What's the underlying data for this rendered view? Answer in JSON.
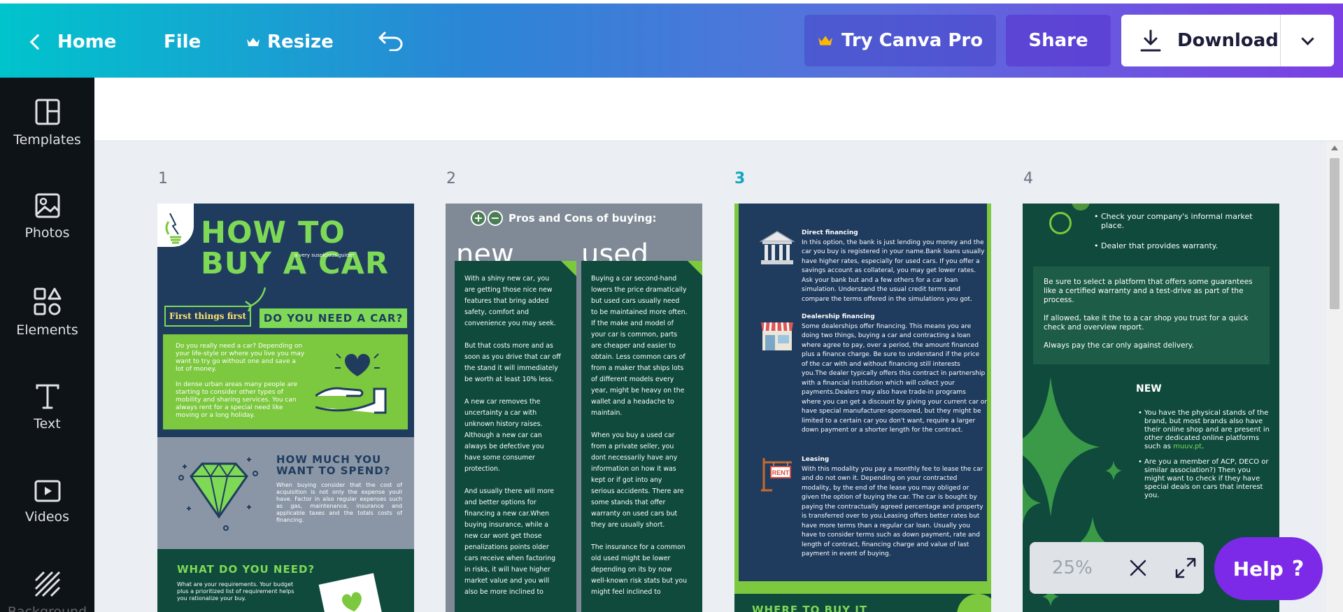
{
  "topbar": {
    "home_label": "Home",
    "file_label": "File",
    "resize_label": "Resize",
    "try_pro_label": "Try Canva Pro",
    "share_label": "Share",
    "download_label": "Download",
    "colors": {
      "gradient_start": "#00c4cc",
      "gradient_end": "#7b3fe4",
      "crown": "#ffb800"
    }
  },
  "sidebar": {
    "items": [
      {
        "label": "Templates",
        "icon": "templates-icon"
      },
      {
        "label": "Photos",
        "icon": "photos-icon"
      },
      {
        "label": "Elements",
        "icon": "elements-icon"
      },
      {
        "label": "Text",
        "icon": "text-icon"
      },
      {
        "label": "Videos",
        "icon": "videos-icon"
      },
      {
        "label": "Background",
        "icon": "background-icon"
      }
    ]
  },
  "pages": {
    "numbers": [
      "1",
      "2",
      "3",
      "4"
    ],
    "active_page": "3"
  },
  "page1": {
    "title": "HOW TO BUY A CAR",
    "subtitle": "a very suspicious guide*",
    "first_things": "First things first",
    "need_car": "DO YOU NEED A CAR?",
    "need_car_text": "Do you really need a car? Depending on your life-style or where you live you may want to try go without one and save a lot of money.\n\nIn dense urban areas many people are starting to consider other types of mobility and sharing services. You can always rent for a special need like moving or a long holiday.",
    "spend_heading": "HOW MUCH YOU WANT TO SPEND?",
    "spend_text": "When buying consider that the cost of acquisition is not only the expense youll have. Factor in also regular expenses such as gas, maintenance, insurance and applicable taxes and the totals costs of financing.",
    "need_heading": "WHAT DO YOU NEED?",
    "need_text": "What are your requirements. Your budget plus a prioritized list of requirement helps you rationalize your buy."
  },
  "page2": {
    "heading": "Pros and Cons of buying:",
    "new_label": "new",
    "used_label": "used",
    "new_text": "With a shiny new car, you are getting those nice new features that bring added safety, comfort and convenience you may seek.\n\nBut that costs more and as soon as you drive that car off the stand it will immediately be worth at least 10% less.\n\nA new car removes the uncertainty a car with unknown history raises. Although a new car can always be defective you have some consumer protection.\n\nAnd usually there will more and better options for financing a new car.When buying insurance, while a new car wont get those penalizations points older cars receive when factoring in risks, it will have higher market value and you will also be more inclined to",
    "used_text": "Buying a car second-hand lowers the price dramatically but used cars usually need to be maintained more often. If the make and model of your car is common, parts are cheaper and easier to obtain. Less common cars of from a maker that ships lots of different models every year, might be heavy on the wallet and a headache to maintain.\n\nWhen you buy a used car from a private seller, you dont necessarily have any information on how it was kept or if got into any serious accidents. There are some stands that offer warranty on used cars but they are usually short.\n\nThe insurance for a common old used might be lower depending on its by now well-known risk stats but you might feel inclined to"
  },
  "page3": {
    "direct_title": "Direct financing",
    "direct_text": "In this option, the bank is just lending you money and the car you buy is registered in your name.Bank loans usually have higher rates, especially for used cars. If you offer a savings account as collateral, you may get lower rates. Ask your bank but and a few others for a car loan simulation. Understand the usual credit terms and compare the terms offered in the simulations you got.",
    "dealer_title": "Dealership financing",
    "dealer_text": "Some dealerships offer financing. This means you are doing two things, buying a car and contracting a loan where agree to pay, over a period, the amount financed plus a finance charge. Be sure to understand if the price of the car with and without financing still interests you.The dealer typically offers this contract in partnership with a financial institution which will collect your payments.Dealers may also have trade-in programs where you can get a discount by giving your current car or have special manufacturer-sponsored, but they might be limited to a certain car you don't want, require a larger down payment or a shorter length for the contract.",
    "leasing_title": "Leasing",
    "leasing_text": "With this modality you pay a monthly fee to lease the car and do not own it. Depending on your contracted modality, by the end of the lease you may obliged or given the option of buying the car. The car is bought by paying the contractually agreed percentage and property is transferred over to you.Leasing offers better rates but have more terms than a regular car loan. Usually you have to consider terms such as down payment, rate and length of contract, financing charge and value of last payment in event of buying.",
    "rent_sign": "RENT",
    "bottom_heading": "WHERE TO BUY IT"
  },
  "page4": {
    "bullet1": "Check your company's informal market place.",
    "bullet2": "Dealer that provides warranty.",
    "box_text": "Be sure to select a platform that offers some guarantees like a certified warranty and a test-drive as part of the process.\n\nIf allowed, take it the to a car shop you trust for a quick check and overview report.\n\nAlways pay the car only against delivery.",
    "new_heading": "NEW",
    "new_bullet1_pre": "You have the physical stands of the brand, but most brands also have their online shop and are present in other dedicated online platforms such as ",
    "new_bullet1_link": "muuv.pt",
    "new_bullet1_post": ".",
    "new_bullet2": "Are you a member of ACP, DECO or similar association?) Then you might want to check if they have special deals on cars that interest you."
  },
  "zoom": {
    "value": "25%"
  },
  "help": {
    "label": "Help",
    "symbol": "?"
  }
}
